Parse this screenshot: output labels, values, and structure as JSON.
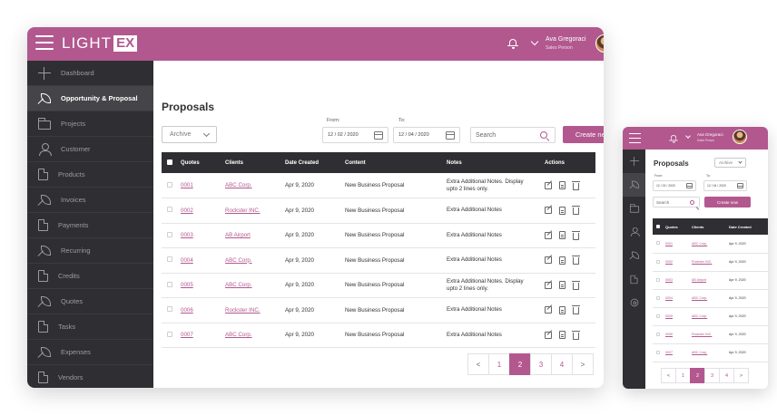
{
  "app": {
    "logo_text": "LIGHT",
    "logo_box": "EX",
    "user_name": "Ava Gregoraci",
    "user_role": "Sales Person"
  },
  "sidebar": {
    "items": [
      {
        "label": "Dashboard",
        "icon": "move-icon"
      },
      {
        "label": "Opportunity & Proposal",
        "icon": "feather-icon"
      },
      {
        "label": "Projects",
        "icon": "folder-icon"
      },
      {
        "label": "Customer",
        "icon": "user-icon"
      },
      {
        "label": "Products",
        "icon": "document-icon"
      },
      {
        "label": "Invoices",
        "icon": "feather-icon"
      },
      {
        "label": "Payments",
        "icon": "document-icon"
      },
      {
        "label": "Recurring",
        "icon": "feather-icon"
      },
      {
        "label": "Credits",
        "icon": "document-icon"
      },
      {
        "label": "Quotes",
        "icon": "feather-icon"
      },
      {
        "label": "Tasks",
        "icon": "document-icon"
      },
      {
        "label": "Expenses",
        "icon": "feather-icon"
      },
      {
        "label": "Vendors",
        "icon": "document-icon"
      }
    ],
    "active_index": 1
  },
  "page": {
    "title": "Proposals",
    "filter_value": "Archive",
    "from_label": "From:",
    "from_value": "12 / 02 / 2020",
    "to_label": "To:",
    "to_value": "12 / 04 / 2020",
    "search_placeholder": "Search",
    "create_label": "Create new"
  },
  "table": {
    "headers": {
      "quotes": "Quotes",
      "clients": "Clients",
      "date": "Date Created",
      "content": "Content",
      "notes": "Notes",
      "actions": "Actions"
    },
    "rows": [
      {
        "quote": "0001",
        "client": "ABC Corp.",
        "date": "Apr 9, 2020",
        "content": "New Business Proposal",
        "notes": "Extra Additional Notes. Display upto 2 lines only."
      },
      {
        "quote": "0002",
        "client": "Rockster INC.",
        "date": "Apr 9, 2020",
        "content": "New Business Proposal",
        "notes": "Extra Additional Notes"
      },
      {
        "quote": "0003",
        "client": "AB Airport",
        "date": "Apr 9, 2020",
        "content": "New Business Proposal",
        "notes": "Extra Additional Notes"
      },
      {
        "quote": "0004",
        "client": "ABC Corp.",
        "date": "Apr 9, 2020",
        "content": "New Business Proposal",
        "notes": "Extra Additional Notes"
      },
      {
        "quote": "0005",
        "client": "ABC Corp.",
        "date": "Apr 9, 2020",
        "content": "New Business Proposal",
        "notes": "Extra Additional Notes. Display upto 2 lines only."
      },
      {
        "quote": "0006",
        "client": "Rockster INC.",
        "date": "Apr 9, 2020",
        "content": "New Business Proposal",
        "notes": "Extra Additional Notes"
      },
      {
        "quote": "0007",
        "client": "ABC Corp.",
        "date": "Apr 9, 2020",
        "content": "New Business Proposal",
        "notes": "Extra Additional Notes"
      }
    ]
  },
  "pagination": {
    "prev": "<",
    "next": ">",
    "pages": [
      "1",
      "2",
      "3",
      "4"
    ],
    "active": "2"
  },
  "mobile": {
    "sidebar_icons": [
      "move-icon",
      "feather-icon",
      "folder-icon",
      "user-icon",
      "feather-icon",
      "document-icon",
      "gear-icon"
    ]
  },
  "colors": {
    "accent": "#b2588f",
    "sidebar": "#2f2f33",
    "sidebar_active": "#454549"
  }
}
